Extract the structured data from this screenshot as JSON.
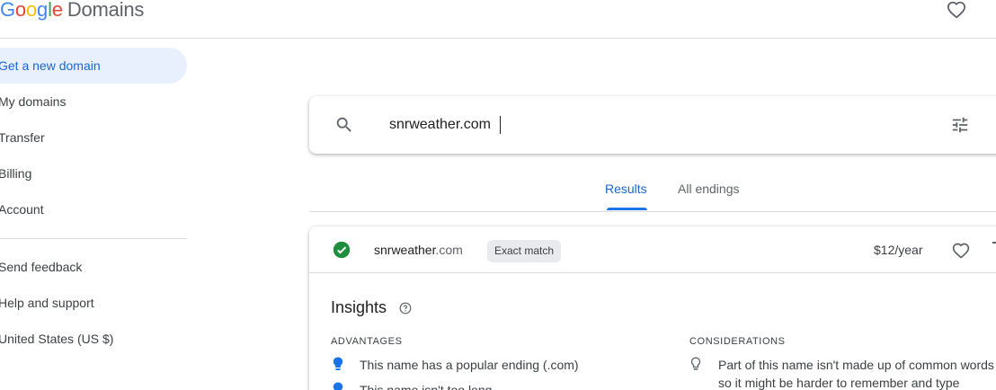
{
  "header": {
    "logo_letters": [
      "G",
      "o",
      "o",
      "g",
      "l",
      "e"
    ],
    "product": "Domains",
    "favorites_icon": "heart-outline-icon"
  },
  "sidebar": {
    "items": [
      {
        "label": "Get a new domain",
        "active": true
      },
      {
        "label": "My domains"
      },
      {
        "label": "Transfer"
      },
      {
        "label": "Billing"
      },
      {
        "label": "Account"
      }
    ],
    "secondary": [
      {
        "label": "Send feedback"
      },
      {
        "label": "Help and support"
      },
      {
        "label": "United States (US $)"
      }
    ]
  },
  "search": {
    "value": "snrweather.com",
    "search_icon": "search-icon",
    "filter_icon": "tune-icon"
  },
  "tabs": [
    {
      "label": "Results",
      "active": true
    },
    {
      "label": "All endings"
    }
  ],
  "result": {
    "name": "snrweather",
    "tld": ".com",
    "badge": "Exact match",
    "price": "$12/year",
    "status_icon": "check-circle-icon",
    "status_color": "#1e8e3e"
  },
  "insights": {
    "title": "Insights",
    "advantages_heading": "ADVANTAGES",
    "advantages": [
      "This name has a popular ending (.com)",
      "This name isn't too long"
    ],
    "considerations_heading": "CONSIDERATIONS",
    "considerations": [
      "Part of this name isn't made up of common words",
      "so it might be harder to remember and type"
    ]
  },
  "colors": {
    "accent": "#1a73e8",
    "active_nav_bg": "#e8f0fe",
    "advantage_bulb": "#1a73e8"
  }
}
